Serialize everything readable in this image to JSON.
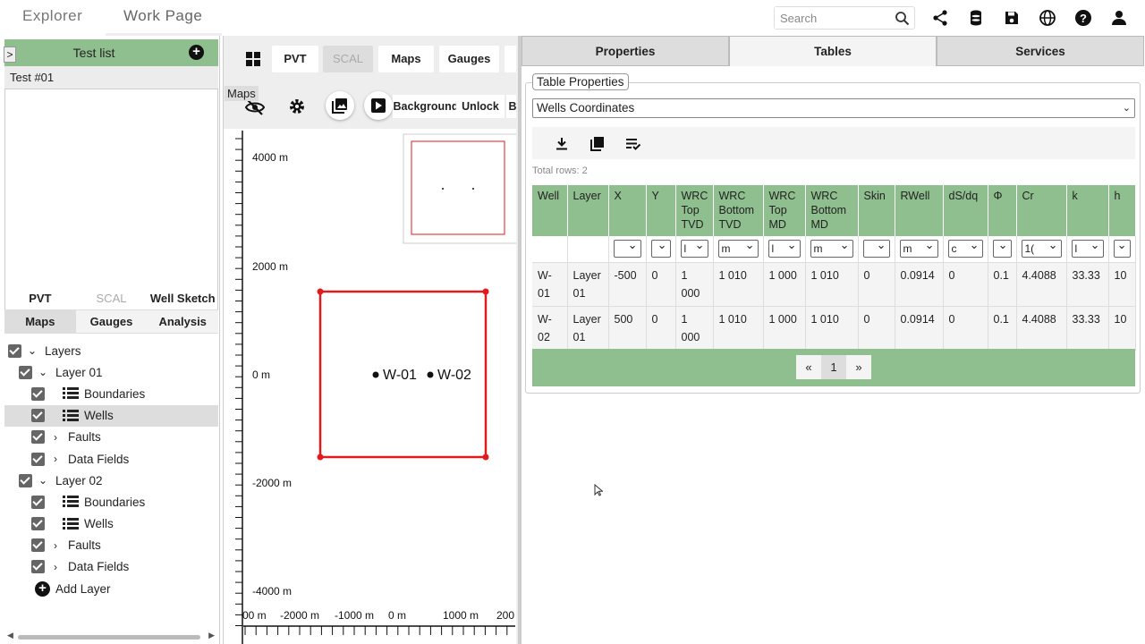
{
  "topbar": {
    "tabs": [
      "Explorer",
      "Work Page"
    ],
    "search_placeholder": "Search",
    "icons": [
      "search-icon",
      "share-icon",
      "database-icon",
      "save-icon",
      "globe-icon",
      "help-icon",
      "user-icon"
    ]
  },
  "left": {
    "collapse": ">",
    "testlist_title": "Test list",
    "test_item": "Test #01",
    "tabs1": [
      "PVT",
      "SCAL",
      "Well Sketch"
    ],
    "tabs2": [
      "Maps",
      "Gauges",
      "Analysis"
    ],
    "layers": {
      "root": "Layers",
      "layer1": "Layer 01",
      "layer2": "Layer 02",
      "boundaries": "Boundaries",
      "wells": "Wells",
      "faults": "Faults",
      "data_fields": "Data Fields",
      "add_layer": "Add Layer"
    }
  },
  "mid": {
    "tabs": [
      "PVT",
      "SCAL",
      "Maps",
      "Gauges"
    ],
    "maps_label": "Maps",
    "tools": {
      "background": "Background",
      "unlock": "Unlock",
      "more": "B"
    },
    "y_ticks": [
      "4000 m",
      "2000 m",
      "0 m",
      "-2000 m",
      "-4000 m"
    ],
    "x_ticks": [
      "00 m",
      "-2000 m",
      "-1000 m",
      "0 m",
      "1000 m",
      "200"
    ],
    "wells": [
      "W-01",
      "W-02"
    ]
  },
  "right": {
    "tabs": [
      "Properties",
      "Tables",
      "Services"
    ],
    "legend": "Table Properties",
    "selected_table": "Wells Coordinates",
    "total_rows": "Total rows: 2",
    "columns": [
      "Well",
      "Layer",
      "X",
      "Y",
      "WRC Top TVD",
      "WRC Bottom TVD",
      "WRC Top MD",
      "WRC Bottom MD",
      "Skin",
      "RWell",
      "dS/dq",
      "Φ",
      "Cr",
      "k",
      "h"
    ],
    "filters": [
      "",
      "",
      "",
      "",
      "l",
      "m",
      "l",
      "m",
      "",
      "m",
      "c",
      "",
      "1(",
      "l",
      ""
    ],
    "rows": [
      [
        "W-01",
        "Layer 01",
        "-500",
        "0",
        "1 000",
        "1 010",
        "1 000",
        "1 010",
        "0",
        "0.0914",
        "0",
        "0.1",
        "4.4088",
        "33.33",
        "10"
      ],
      [
        "W-02",
        "Layer 01",
        "500",
        "0",
        "1 000",
        "1 010",
        "1 000",
        "1 010",
        "0",
        "0.0914",
        "0",
        "0.1",
        "4.4088",
        "33.33",
        "10"
      ]
    ],
    "pager": [
      "«",
      "1",
      "»"
    ]
  },
  "colors": {
    "accent_green": "#8fbf8f",
    "boundary_red": "#e31a1c"
  }
}
